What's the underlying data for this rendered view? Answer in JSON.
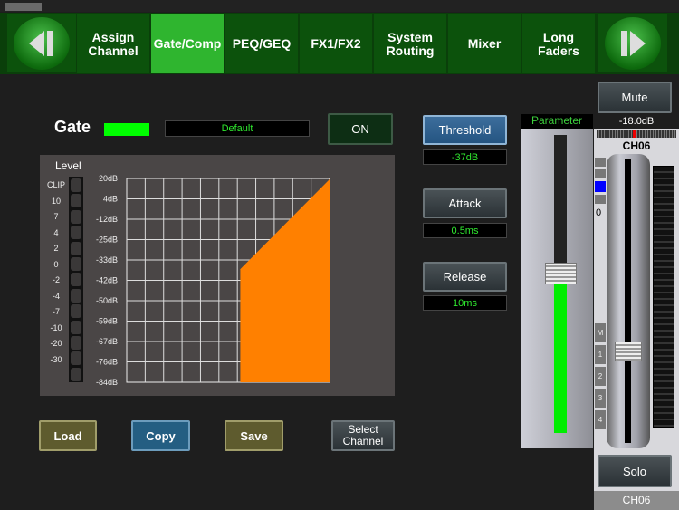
{
  "nav": {
    "prev": "previous-page",
    "next": "next-page",
    "tabs": [
      {
        "label": "Assign\nChannel",
        "active": false
      },
      {
        "label": "Gate/Comp",
        "active": true
      },
      {
        "label": "PEQ/GEQ",
        "active": false
      },
      {
        "label": "FX1/FX2",
        "active": false
      },
      {
        "label": "System\nRouting",
        "active": false
      },
      {
        "label": "Mixer",
        "active": false
      },
      {
        "label": "Long\nFaders",
        "active": false
      }
    ]
  },
  "gate": {
    "title": "Gate",
    "indicator_color": "#00ff00",
    "preset": "Default",
    "on_label": "ON"
  },
  "level": {
    "title": "Level",
    "meter_labels": [
      "CLIP",
      "10",
      "7",
      "4",
      "2",
      "0",
      "-2",
      "-4",
      "-7",
      "-10",
      "-20",
      "-30"
    ]
  },
  "graph": {
    "y_labels": [
      "20dB",
      "4dB",
      "-12dB",
      "-25dB",
      "-33dB",
      "-42dB",
      "-50dB",
      "-59dB",
      "-67dB",
      "-76dB",
      "-84dB"
    ],
    "fill_color": "#ff8000"
  },
  "params": {
    "threshold_label": "Threshold",
    "threshold_value": "-37dB",
    "attack_label": "Attack",
    "attack_value": "0.5ms",
    "release_label": "Release",
    "release_value": "10ms"
  },
  "bottom": {
    "load": "Load",
    "copy": "Copy",
    "save": "Save",
    "select_channel": "Select\nChannel"
  },
  "parameter": {
    "title": "Parameter",
    "level_fraction": 0.5
  },
  "channel": {
    "mute": "Mute",
    "gain": "-18.0dB",
    "name": "CH06",
    "zero": "0",
    "buses": [
      "M",
      "1",
      "2",
      "3",
      "4"
    ],
    "solo": "Solo",
    "footer": "CH06"
  }
}
